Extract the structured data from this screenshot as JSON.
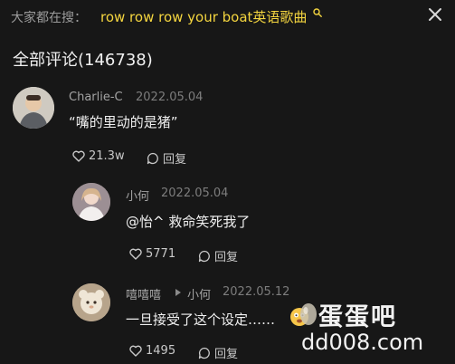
{
  "search": {
    "prefix": "大家都在搜：",
    "query": "row row row your boat英语歌曲"
  },
  "comments_title": "全部评论(146738)",
  "comments": [
    {
      "username": "Charlie-C",
      "date": "2022.05.04",
      "text": "“嘴的里动的是猪”",
      "likes": "21.3w",
      "reply_label": "回复"
    },
    {
      "username": "小何",
      "date": "2022.05.04",
      "text": "@怡^ 救命笑死我了",
      "likes": "5771",
      "reply_label": "回复"
    },
    {
      "username": "嘻嘻嘻",
      "reply_to": "小何",
      "date": "2022.05.12",
      "text": "一旦接受了这个设定……",
      "likes": "1495",
      "reply_label": "回复"
    }
  ],
  "watermark": {
    "logo": "蛋蛋吧",
    "url": "dd008.com"
  },
  "colors": {
    "background": "#171717",
    "query": "#f4d53f",
    "muted": "#9b9b9b"
  }
}
